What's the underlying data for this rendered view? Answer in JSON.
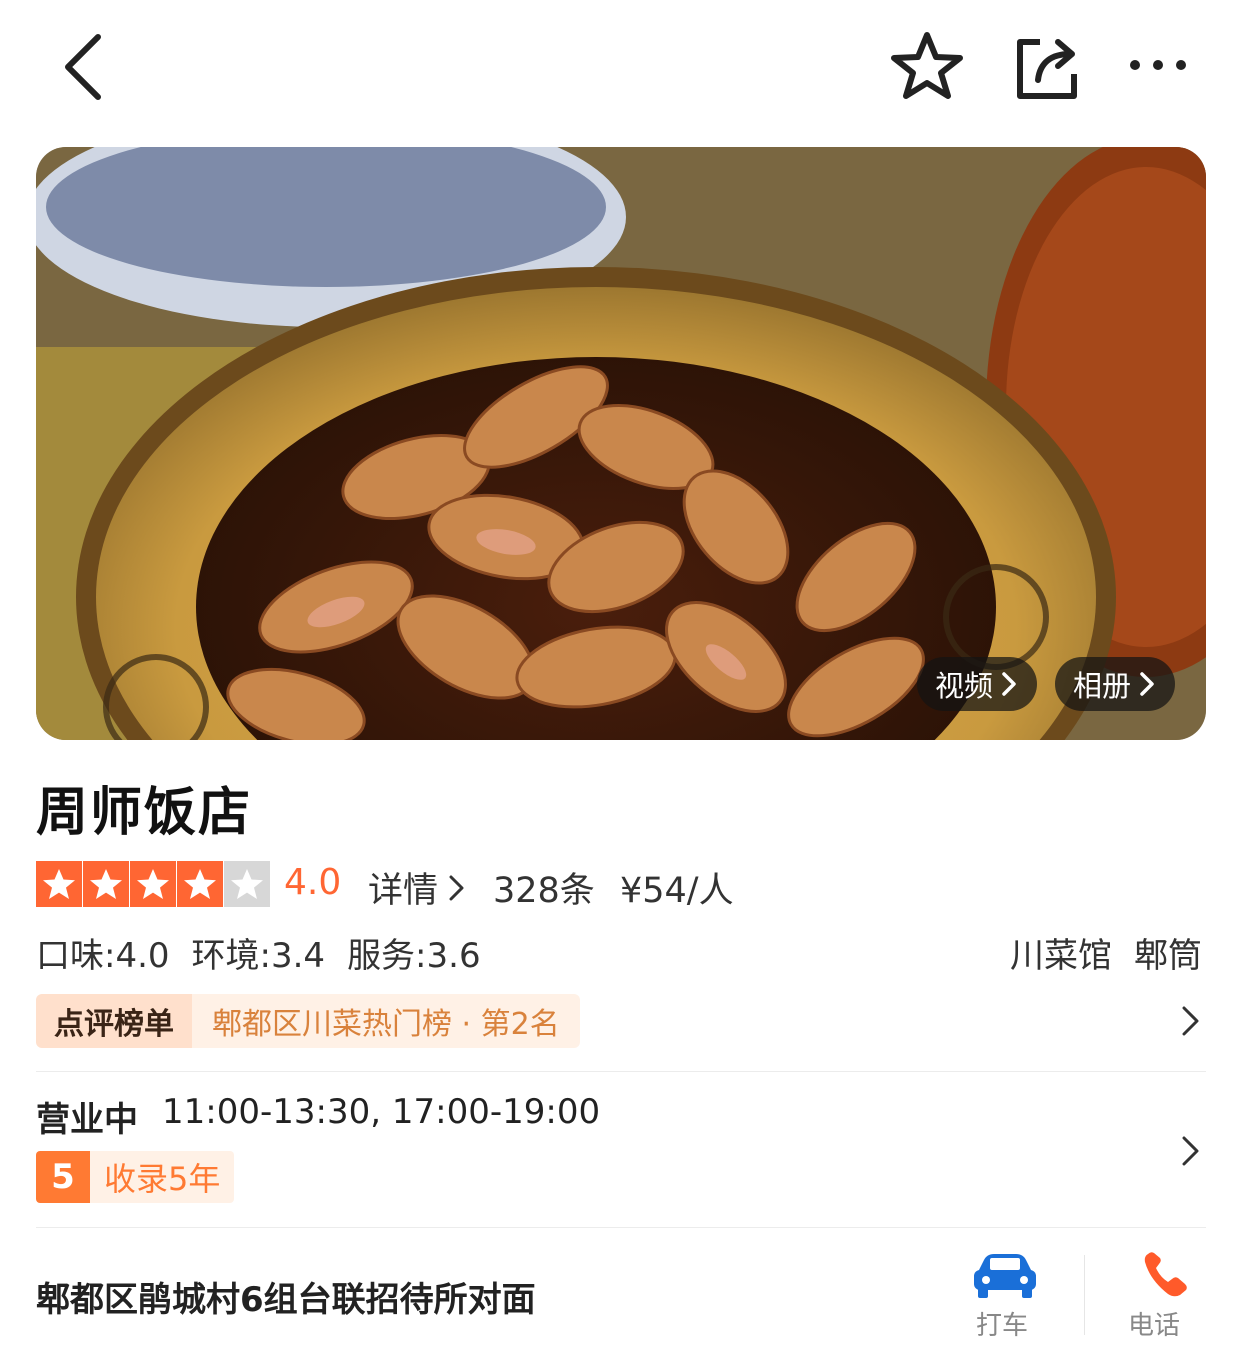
{
  "header": {
    "back_icon": "chevron-left-icon",
    "favorite_icon": "star-outline-icon",
    "share_icon": "share-icon",
    "more_icon": "more-horizontal-icon"
  },
  "gallery": {
    "video_label": "视频",
    "album_label": "相册"
  },
  "shop": {
    "name": "周师饭店",
    "rating": "4.0",
    "rating_stars": 4,
    "rating_max": 5,
    "detail_label": "详情",
    "review_count": "328条",
    "price_per_person": "¥54/人",
    "subscores": [
      {
        "text": "口味:4.0"
      },
      {
        "text": "环境:3.4"
      },
      {
        "text": "服务:3.6"
      }
    ],
    "tags": [
      "川菜馆",
      "郫筒"
    ],
    "ranking_badge": "点评榜单",
    "ranking_text": "郫都区川菜热门榜 · 第2名",
    "business_status": "营业中",
    "business_hours": "11:00-13:30, 17:00-19:00",
    "years_number": "5",
    "years_label": "收录5年",
    "address": "郫都区鹃城村6组台联招待所对面",
    "taxi_label": "打车",
    "phone_label": "电话"
  },
  "colors": {
    "accent": "#ff6633",
    "star_off": "#d7d7d7",
    "rank_text": "#d9823c",
    "taxi_blue": "#1a6fd8"
  }
}
